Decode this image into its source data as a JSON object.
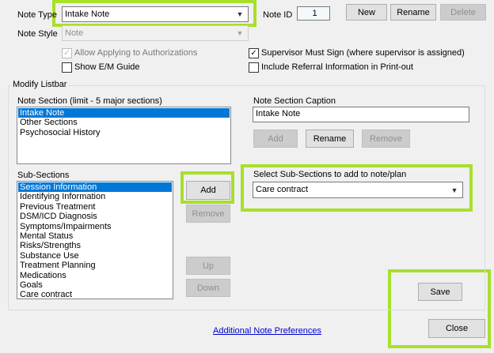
{
  "note_type": {
    "label": "Note Type",
    "value": "Intake Note"
  },
  "note_id": {
    "label": "Note ID",
    "value": "1"
  },
  "top_buttons": {
    "new": "New",
    "rename": "Rename",
    "delete": "Delete"
  },
  "note_style": {
    "label": "Note Style",
    "value": "Note"
  },
  "checkboxes": {
    "allow_applying": {
      "label": "Allow Applying to Authorizations",
      "checked": true,
      "enabled": false
    },
    "show_em_guide": {
      "label": "Show E/M Guide",
      "checked": false,
      "enabled": true
    },
    "supervisor_must_sign": {
      "label": "Supervisor Must Sign (where supervisor is assigned)",
      "checked": true,
      "enabled": true
    },
    "include_referral": {
      "label": "Include Referral Information in Print-out",
      "checked": false,
      "enabled": true
    }
  },
  "modify_listbar": {
    "title": "Modify Listbar",
    "note_section_label": "Note Section (limit - 5 major sections)",
    "note_sections": [
      "Intake Note",
      "Other Sections",
      "Psychosocial History"
    ],
    "note_sections_selected": 0,
    "caption_label": "Note Section Caption",
    "caption_value": "Intake Note",
    "section_buttons": {
      "add": "Add",
      "rename": "Rename",
      "remove": "Remove"
    },
    "sub_sections_label": "Sub-Sections",
    "sub_sections": [
      "Session Information",
      "Identifying Information",
      "Previous Treatment",
      "DSM/ICD Diagnosis",
      "Symptoms/Impairments",
      "Mental Status",
      "Risks/Strengths",
      "Substance Use",
      "Treatment Planning",
      "Medications",
      "Goals",
      "Care contract"
    ],
    "sub_sections_selected": 0,
    "sub_buttons": {
      "add": "Add",
      "remove": "Remove",
      "up": "Up",
      "down": "Down"
    },
    "select_sub_label": "Select Sub-Sections to add to note/plan",
    "select_sub_value": "Care contract"
  },
  "bottom": {
    "save": "Save",
    "close": "Close",
    "preferences_link": "Additional Note Preferences"
  },
  "colors": {
    "highlight": "#a8e02a",
    "selection": "#0078d7"
  },
  "icons": {
    "dropdown": "chevron-down-icon",
    "check": "checkmark-icon"
  }
}
